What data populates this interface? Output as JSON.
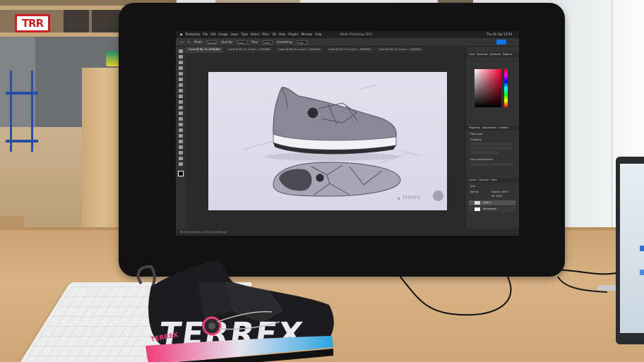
{
  "site_logo": {
    "text": "TRR"
  },
  "photoshop": {
    "app_title": "Adobe Photoshop 2023",
    "menu": [
      "Photoshop",
      "File",
      "Edit",
      "Image",
      "Layer",
      "Type",
      "Select",
      "Filter",
      "3D",
      "View",
      "Plugins",
      "Window",
      "Help"
    ],
    "clock": "Thu 28. Apr 13:59",
    "options": {
      "mode_label": "Mode:",
      "mode_value": "Normal",
      "opacity_label": "Opacity:",
      "opacity_value": "100%",
      "flow_label": "Flow:",
      "flow_value": "100%",
      "smoothing_label": "Smoothing:",
      "smoothing_value": "10%"
    },
    "tabs": [
      "3.psd @ 66,7% (RGB/8#)",
      "3.psd @ 66,7% (Layer 1, RGB/8#)",
      "3.psd @ 66,7% (Layer 1, RGB/8#)",
      "3.psd @ 66,7% (Layer 1, RGB/8#)",
      "3.psd @ 66,7% (Layer 1, RGB/8#)"
    ],
    "panels": {
      "color_tabs": [
        "Color",
        "Swatches",
        "Gradients",
        "Patterns"
      ],
      "properties_tabs": [
        "Properties",
        "Adjustments",
        "Libraries"
      ],
      "pixel_layer_label": "Pixel Layer",
      "transform_label": "Transform",
      "align_label": "Align and Distribute",
      "layers_tabs": [
        "Layers",
        "Channels",
        "Paths"
      ],
      "kind_label": "Kind",
      "blend_value": "Normal",
      "opacity_label": "Opacity: 100%",
      "fill_label": "Fill: 100%",
      "layer_names": [
        "Layer 1",
        "Background"
      ]
    },
    "status": "66,67%   4000 px x 2250 px (300 ppi)"
  },
  "artboard": {
    "brand_text": "TERREX"
  },
  "colors": {
    "logo_red": "#c91f26",
    "ps_blue": "#1473e6",
    "shoe_pink": "#ef3d7a",
    "shoe_blue": "#2aa5e0"
  }
}
